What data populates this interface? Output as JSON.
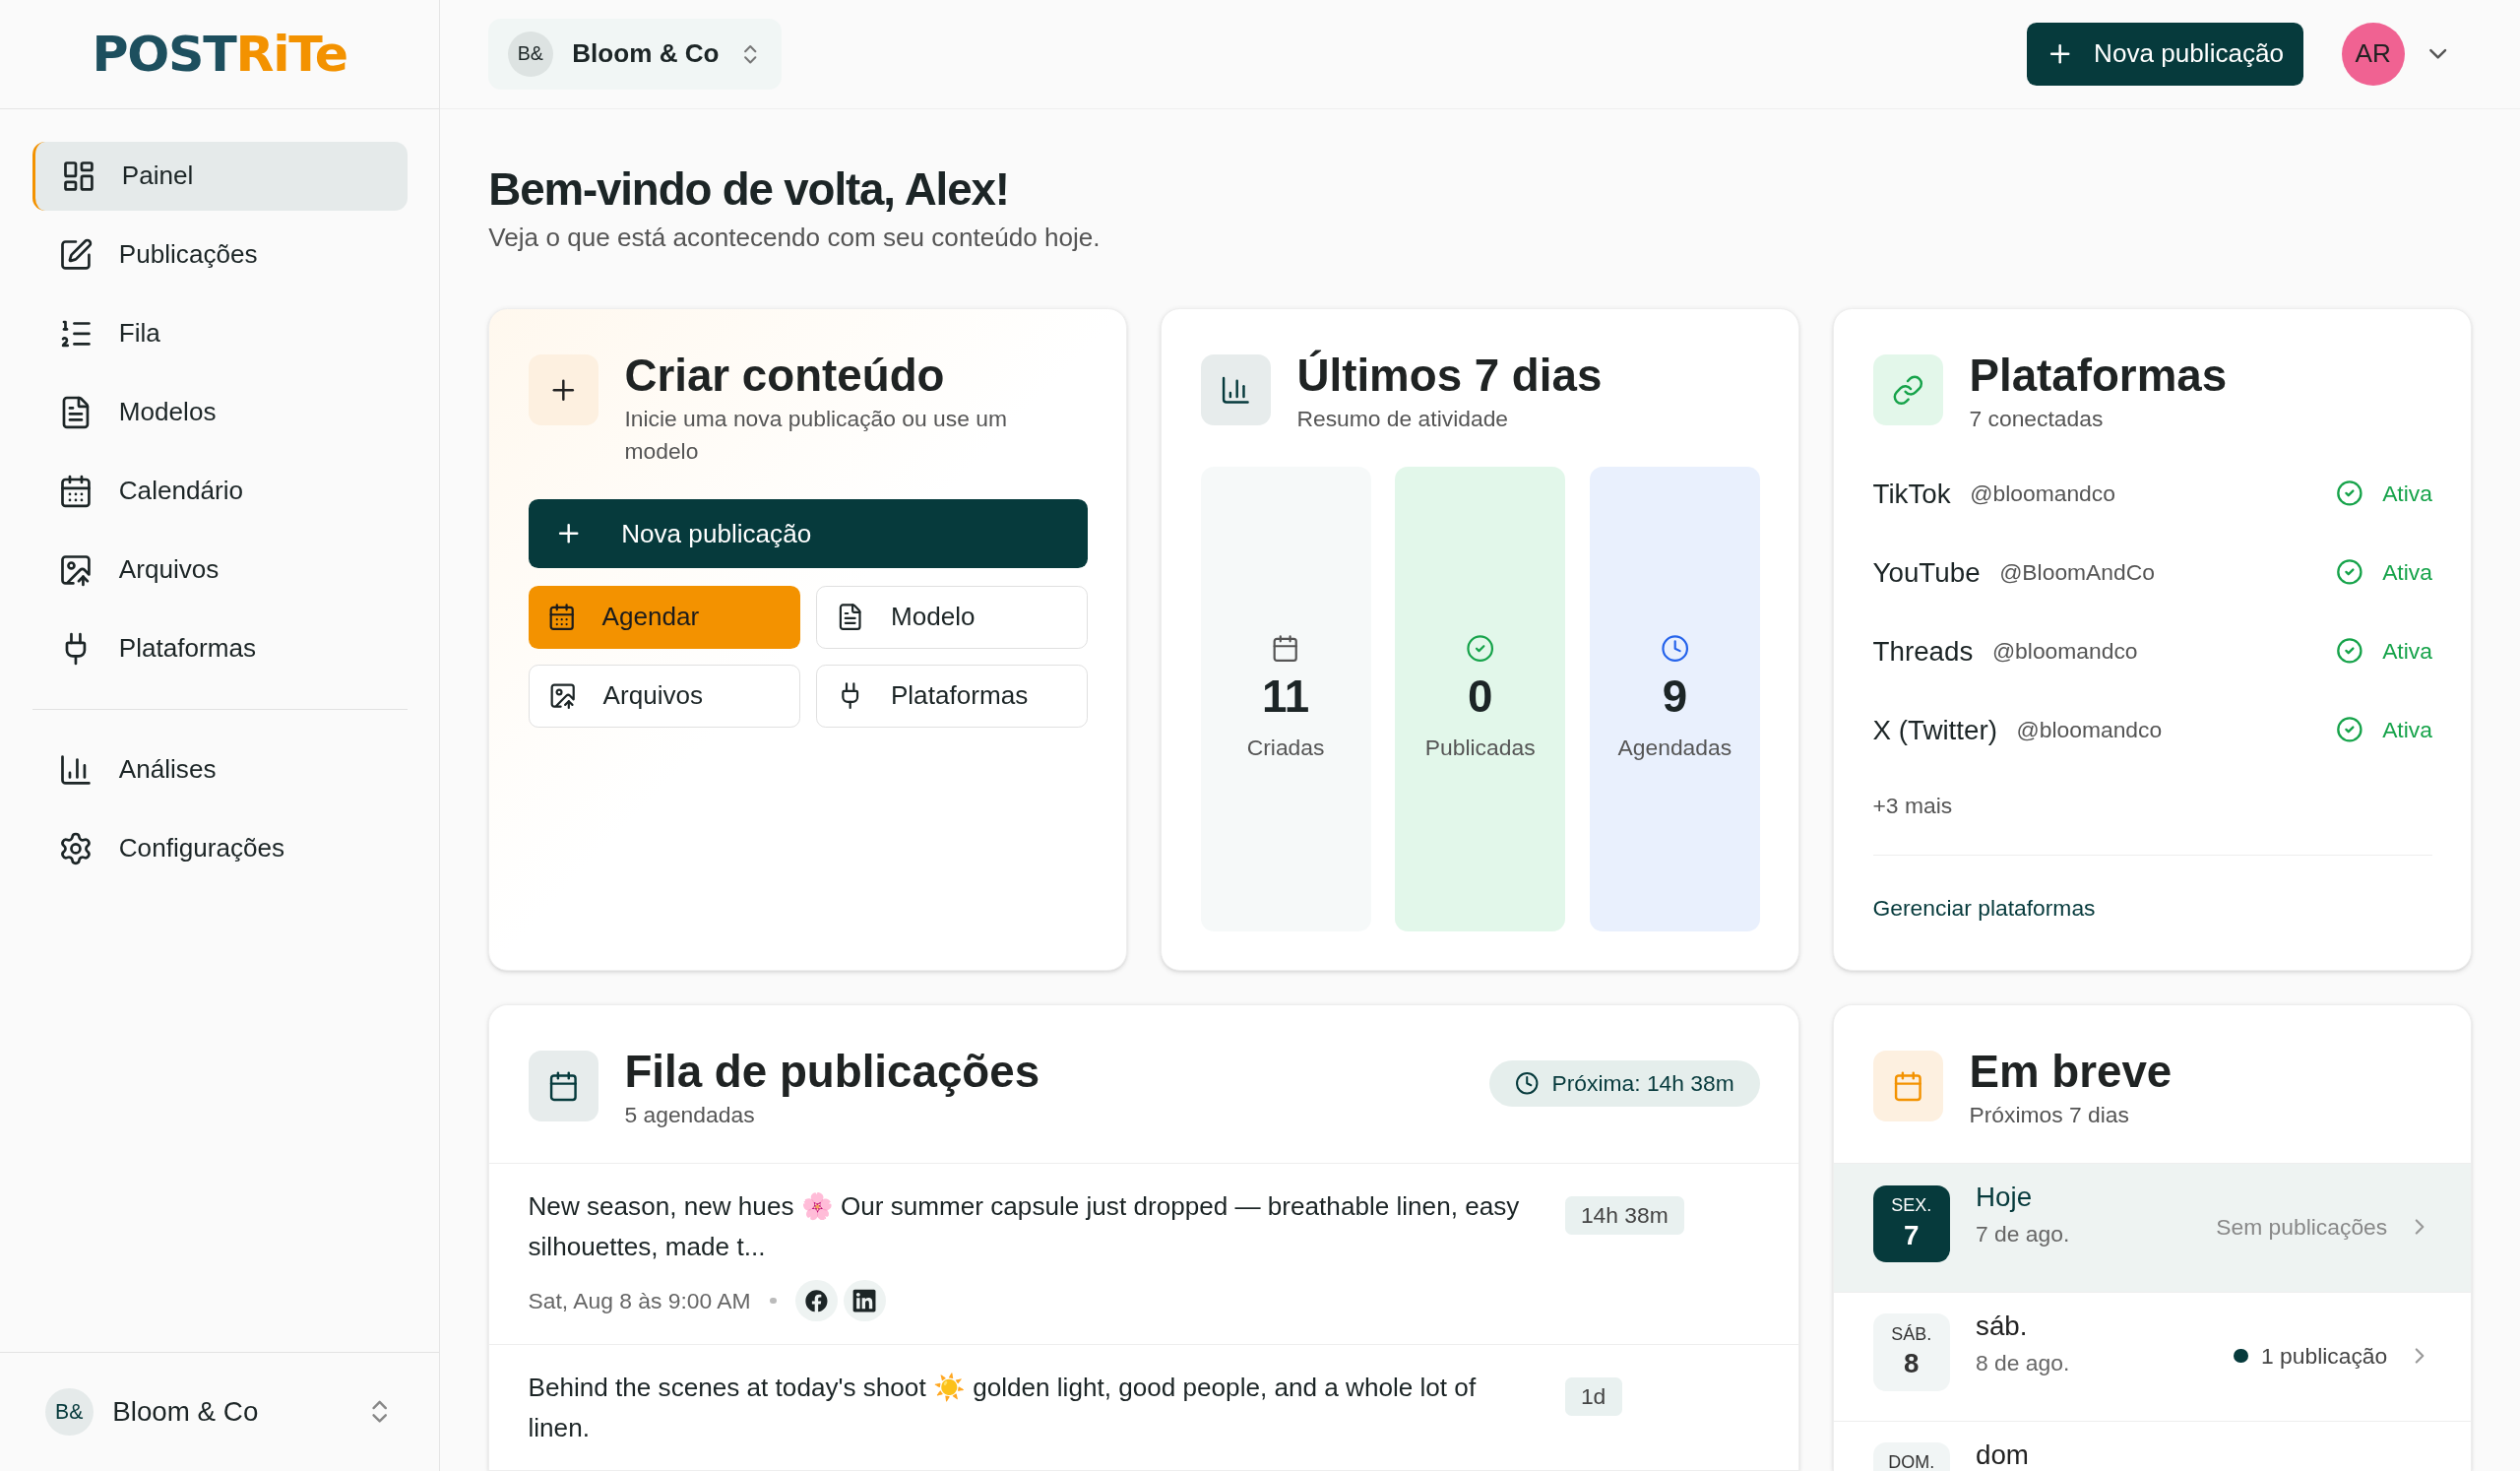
{
  "logo": [
    {
      "text": "POST",
      "kind": "primary"
    },
    {
      "text": "RiTe",
      "kind": "accent"
    }
  ],
  "sidebar": {
    "items": [
      {
        "label": "Painel",
        "selected": true
      },
      {
        "label": "Publicações",
        "selected": false
      },
      {
        "label": "Fila",
        "selected": false
      },
      {
        "label": "Modelos",
        "selected": false
      },
      {
        "label": "Calendário",
        "selected": false
      },
      {
        "label": "Arquivos",
        "selected": false
      },
      {
        "label": "Plataformas",
        "selected": false
      }
    ],
    "secondary_items": [
      {
        "label": "Análises",
        "selected": false
      },
      {
        "label": "Configurações",
        "selected": false
      }
    ],
    "account": {
      "initials": "B&",
      "name": "Bloom & Co"
    }
  },
  "header": {
    "workspace": {
      "initials": "B&",
      "name": "Bloom & Co"
    },
    "new_post_button": "Nova publicação",
    "user": {
      "initials": "AR"
    }
  },
  "welcome": {
    "title": "Bem-vindo de volta, Alex!",
    "subtitle": "Veja o que está acontecendo com seu conteúdo hoje."
  },
  "create_card": {
    "title": "Criar conteúdo",
    "subtitle": "Inicie uma nova publicação ou use um modelo",
    "primary_button": "Nova publicação",
    "buttons": [
      {
        "label": "Agendar",
        "kind": "accent"
      },
      {
        "label": "Modelo",
        "kind": "outline"
      },
      {
        "label": "Arquivos",
        "kind": "outline"
      },
      {
        "label": "Plataformas",
        "kind": "outline"
      }
    ]
  },
  "stats_card": {
    "title": "Últimos 7 dias",
    "subtitle": "Resumo de atividade",
    "stats": [
      {
        "kind": "created",
        "value": "11",
        "label": "Criadas"
      },
      {
        "kind": "published",
        "value": "0",
        "label": "Publicadas"
      },
      {
        "kind": "scheduled",
        "value": "9",
        "label": "Agendadas"
      }
    ]
  },
  "platforms_card": {
    "title": "Plataformas",
    "subtitle": "7 conectadas",
    "platforms": [
      {
        "name": "TikTok",
        "handle": "@bloomandco",
        "status": "Ativa",
        "active": true
      },
      {
        "name": "YouTube",
        "handle": "@BloomAndCo",
        "status": "Ativa",
        "active": true
      },
      {
        "name": "Threads",
        "handle": "@bloomandco",
        "status": "Ativa",
        "active": true
      },
      {
        "name": "X (Twitter)",
        "handle": "@bloomandco",
        "status": "Ativa",
        "active": true
      }
    ],
    "more": "+3 mais",
    "manage_link": "Gerenciar plataformas"
  },
  "queue_card": {
    "title": "Fila de publicações",
    "subtitle": "5 agendadas",
    "next_badge": "Próxima: 14h 38m",
    "posts": [
      {
        "text": "New season, new hues 🌸  Our summer capsule just dropped — breathable linen, easy silhouettes, made t...",
        "time_badge": "14h 38m",
        "date": "Sat, Aug 8 às 9:00 AM"
      },
      {
        "text": "Behind the scenes at today's shoot ☀️  golden light, good people, and a whole lot of linen.",
        "time_badge": "1d"
      }
    ]
  },
  "upcoming_card": {
    "title": "Em breve",
    "subtitle": "Próximos 7 dias",
    "days": [
      {
        "weekday": "SEX.",
        "day": "7",
        "title": "Hoje",
        "date": "7 de ago.",
        "status": "Sem publicações",
        "has_posts": false,
        "selected": true
      },
      {
        "weekday": "SÁB.",
        "day": "8",
        "title": "sáb.",
        "date": "8 de ago.",
        "status": "1 publicação",
        "has_posts": true,
        "selected": false
      },
      {
        "weekday": "DOM.",
        "title": "dom",
        "selected": false
      }
    ]
  }
}
